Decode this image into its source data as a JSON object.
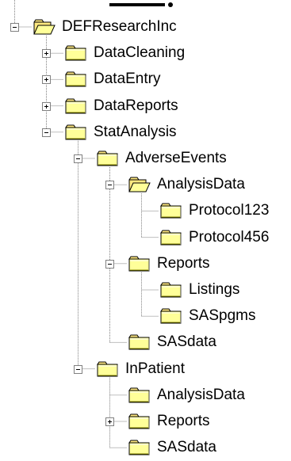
{
  "tree": {
    "nodes": [
      {
        "id": "defresearch",
        "label": "DEFResearchInc",
        "level": 0,
        "state": "minus",
        "open": true
      },
      {
        "id": "datacleaning",
        "label": "DataCleaning",
        "level": 1,
        "state": "plus",
        "open": false
      },
      {
        "id": "dataentry",
        "label": "DataEntry",
        "level": 1,
        "state": "plus",
        "open": false
      },
      {
        "id": "datareports",
        "label": "DataReports",
        "level": 1,
        "state": "plus",
        "open": false
      },
      {
        "id": "statanalysis",
        "label": "StatAnalysis",
        "level": 1,
        "state": "minus",
        "open": false
      },
      {
        "id": "adverseevents",
        "label": "AdverseEvents",
        "level": 2,
        "state": "minus",
        "open": false
      },
      {
        "id": "analysisdata",
        "label": "AnalysisData",
        "level": 3,
        "state": "minus",
        "open": true
      },
      {
        "id": "protocol123",
        "label": "Protocol123",
        "level": 4,
        "state": "none",
        "open": false
      },
      {
        "id": "protocol456",
        "label": "Protocol456",
        "level": 4,
        "state": "none",
        "open": false
      },
      {
        "id": "reports",
        "label": "Reports",
        "level": 3,
        "state": "minus",
        "open": false
      },
      {
        "id": "listings",
        "label": "Listings",
        "level": 4,
        "state": "none",
        "open": false
      },
      {
        "id": "saspgms",
        "label": "SASpgms",
        "level": 4,
        "state": "none",
        "open": false
      },
      {
        "id": "sasdata-ae",
        "label": "SASdata",
        "level": 3,
        "state": "none",
        "open": false
      },
      {
        "id": "inpatient",
        "label": "InPatient",
        "level": 2,
        "state": "minus",
        "open": false
      },
      {
        "id": "analysisdata-ip",
        "label": "AnalysisData",
        "level": 3,
        "state": "none",
        "open": false
      },
      {
        "id": "reports-ip",
        "label": "Reports",
        "level": 3,
        "state": "plus",
        "open": false
      },
      {
        "id": "sasdata-ip",
        "label": "SASdata",
        "level": 3,
        "state": "none",
        "open": false
      }
    ]
  },
  "colors": {
    "folder_fill": "#FFFF99",
    "folder_tab": "#FFE97F",
    "folder_outline": "#808000",
    "dotted_line": "#808080"
  }
}
